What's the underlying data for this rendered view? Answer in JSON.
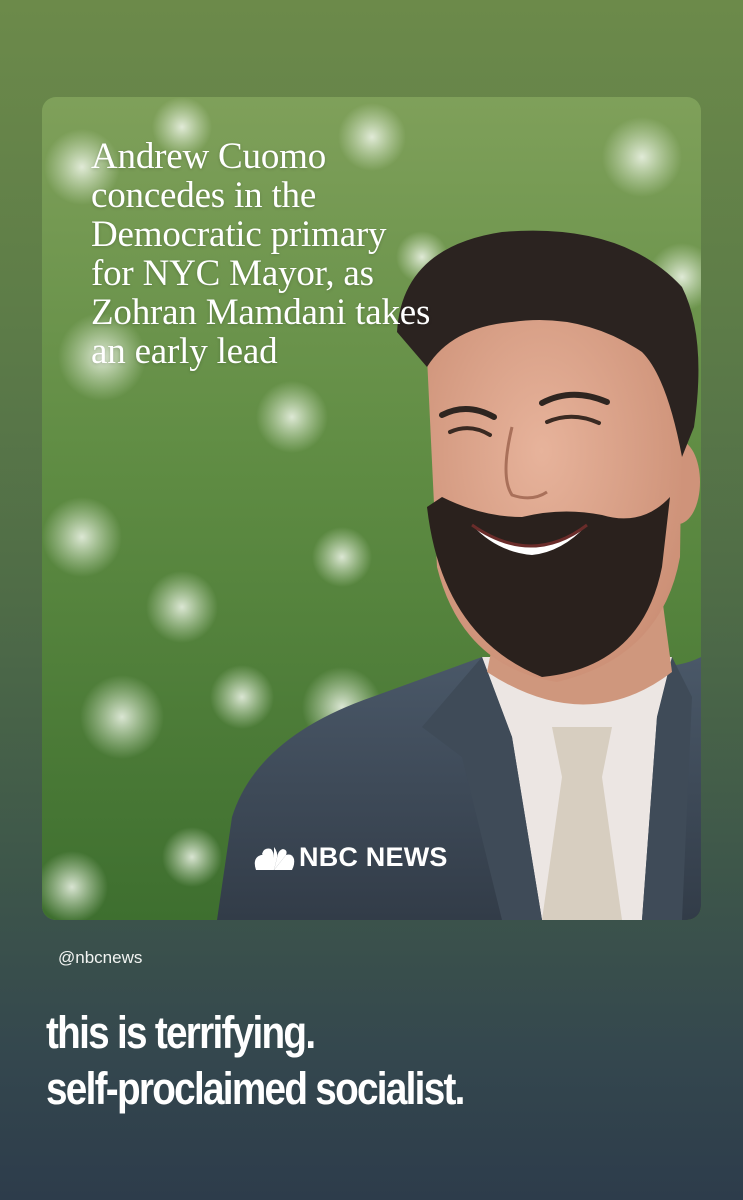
{
  "post": {
    "headline": "Andrew Cuomo concedes in the Democratic primary for NYC Mayor, as Zohran Mamdani takes an early lead",
    "logo_text": "NBC NEWS",
    "handle": "@nbcnews",
    "caption_lines": [
      "this is terrifying.",
      "self-proclaimed socialist."
    ]
  },
  "colors": {
    "background_top": "#6c8a4a",
    "background_bottom": "#2d3c4b",
    "text": "#ffffff"
  },
  "icons": {
    "logo": "nbc-peacock-icon"
  }
}
